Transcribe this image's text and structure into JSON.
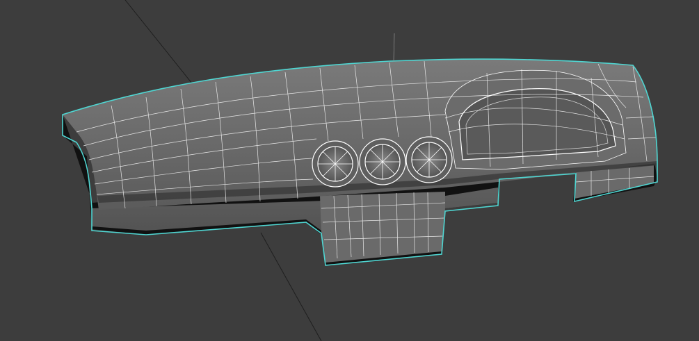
{
  "viewport": {
    "view": "perspective",
    "background_color": "#3d3d3d",
    "selection_outline_color": "#4fd6d2",
    "wireframe_color": "#ffffff",
    "surface_color": "#6e6e6e",
    "grid_line_color": "#1c1c1c"
  },
  "scene": {
    "object": "dashboard-model",
    "display_mode": "smooth-shade-with-wireframe",
    "selected": true,
    "features": [
      "dashboard-top-surface",
      "instrument-cluster-hood",
      "round-air-vent",
      "round-air-vent",
      "round-air-vent",
      "center-console-tab",
      "side-mount-tab"
    ]
  }
}
